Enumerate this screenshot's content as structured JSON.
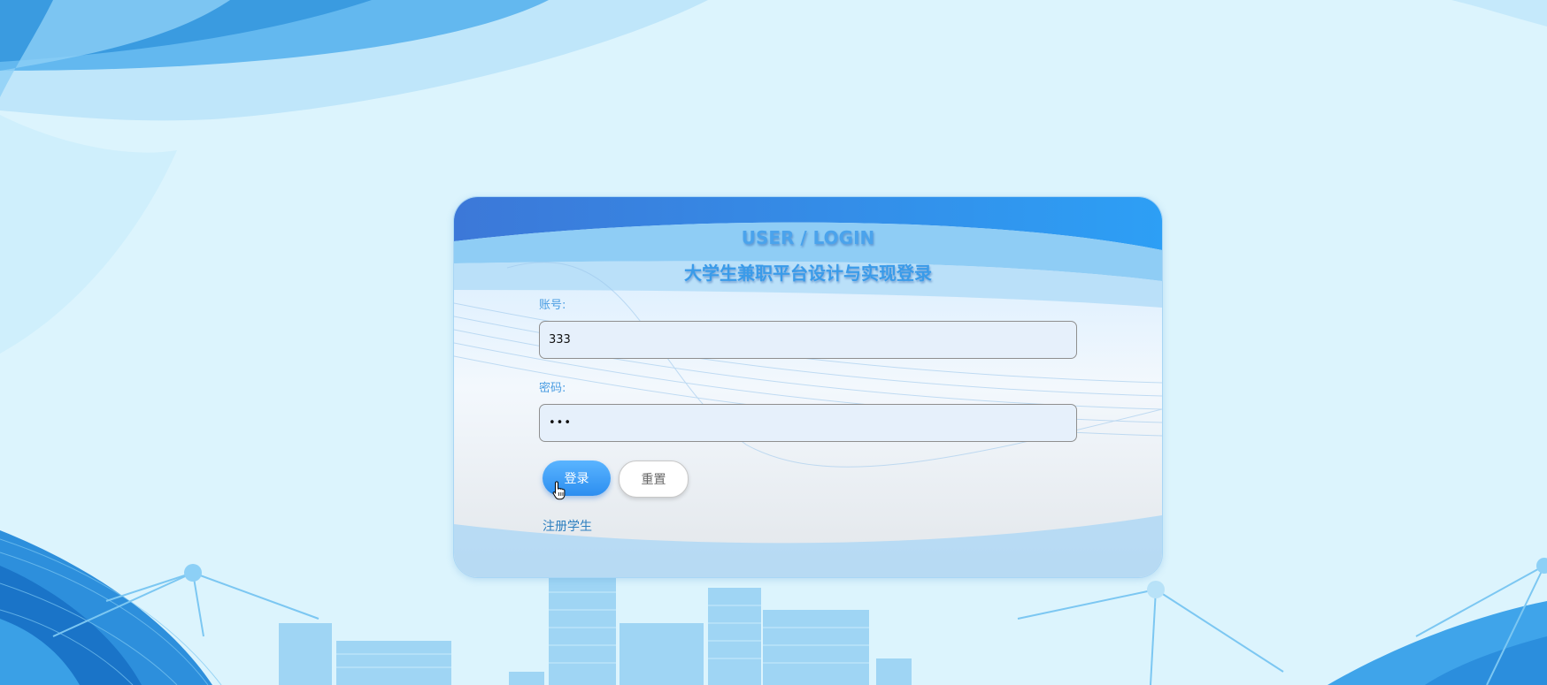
{
  "login": {
    "title": "USER / LOGIN",
    "subtitle": "大学生兼职平台设计与实现登录",
    "account_label": "账号:",
    "account_value": "333",
    "password_label": "密码:",
    "password_value": "•••",
    "login_button": "登录",
    "reset_button": "重置",
    "register_link": "注册学生"
  },
  "colors": {
    "page_background": "#dcf4fd",
    "accent_blue": "#3a9be9",
    "login_button": "#2c8ef0",
    "input_background": "#e6f0fb"
  },
  "icons": {
    "cursor": "hand-pointer-icon"
  }
}
